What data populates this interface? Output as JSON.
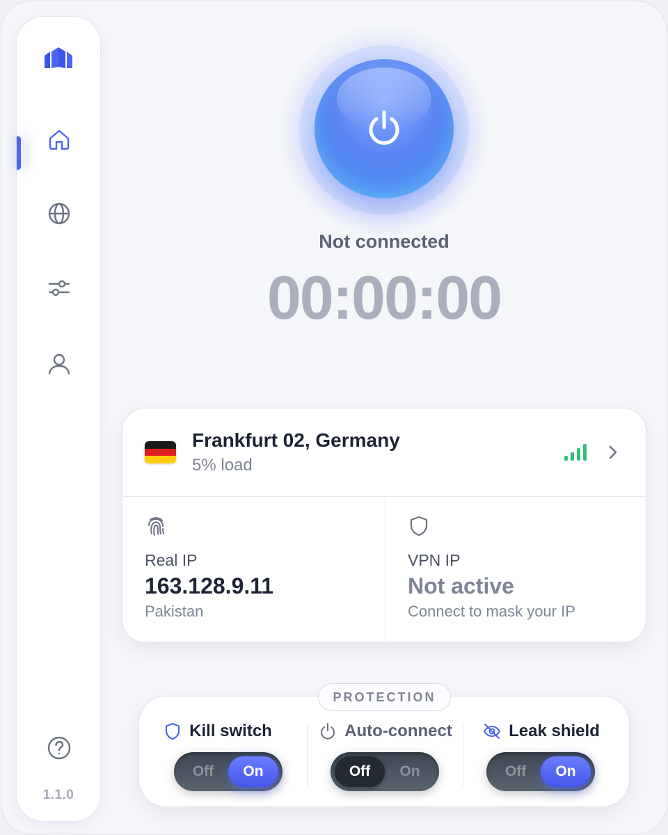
{
  "app": {
    "version": "1.1.0"
  },
  "sidebar": {
    "items": [
      {
        "name": "home",
        "active": true
      },
      {
        "name": "globe",
        "active": false
      },
      {
        "name": "settings",
        "active": false
      },
      {
        "name": "account",
        "active": false
      }
    ],
    "help_icon": "question-circle-icon"
  },
  "connection": {
    "status": "Not connected",
    "timer": "00:00:00"
  },
  "server": {
    "name": "Frankfurt 02, Germany",
    "load": "5% load",
    "flag": "germany-flag",
    "signal_bars": 4
  },
  "real_ip": {
    "label": "Real IP",
    "value": "163.128.9.11",
    "sub": "Pakistan"
  },
  "vpn_ip": {
    "label": "VPN IP",
    "value": "Not active",
    "sub": "Connect to mask your IP"
  },
  "protection": {
    "title": "PROTECTION",
    "items": [
      {
        "label": "Kill switch",
        "icon": "shield-icon",
        "off_label": "Off",
        "on_label": "On",
        "state": "on"
      },
      {
        "label": "Auto-connect",
        "icon": "power-icon",
        "off_label": "Off",
        "on_label": "On",
        "state": "off"
      },
      {
        "label": "Leak shield",
        "icon": "eye-off-icon",
        "off_label": "Off",
        "on_label": "On",
        "state": "on"
      }
    ]
  },
  "colors": {
    "accent": "#4f64f0",
    "signal": "#2fbf7a",
    "flag_black": "#1a1a1a",
    "flag_red": "#dd1f1f",
    "flag_gold": "#ffce00"
  }
}
